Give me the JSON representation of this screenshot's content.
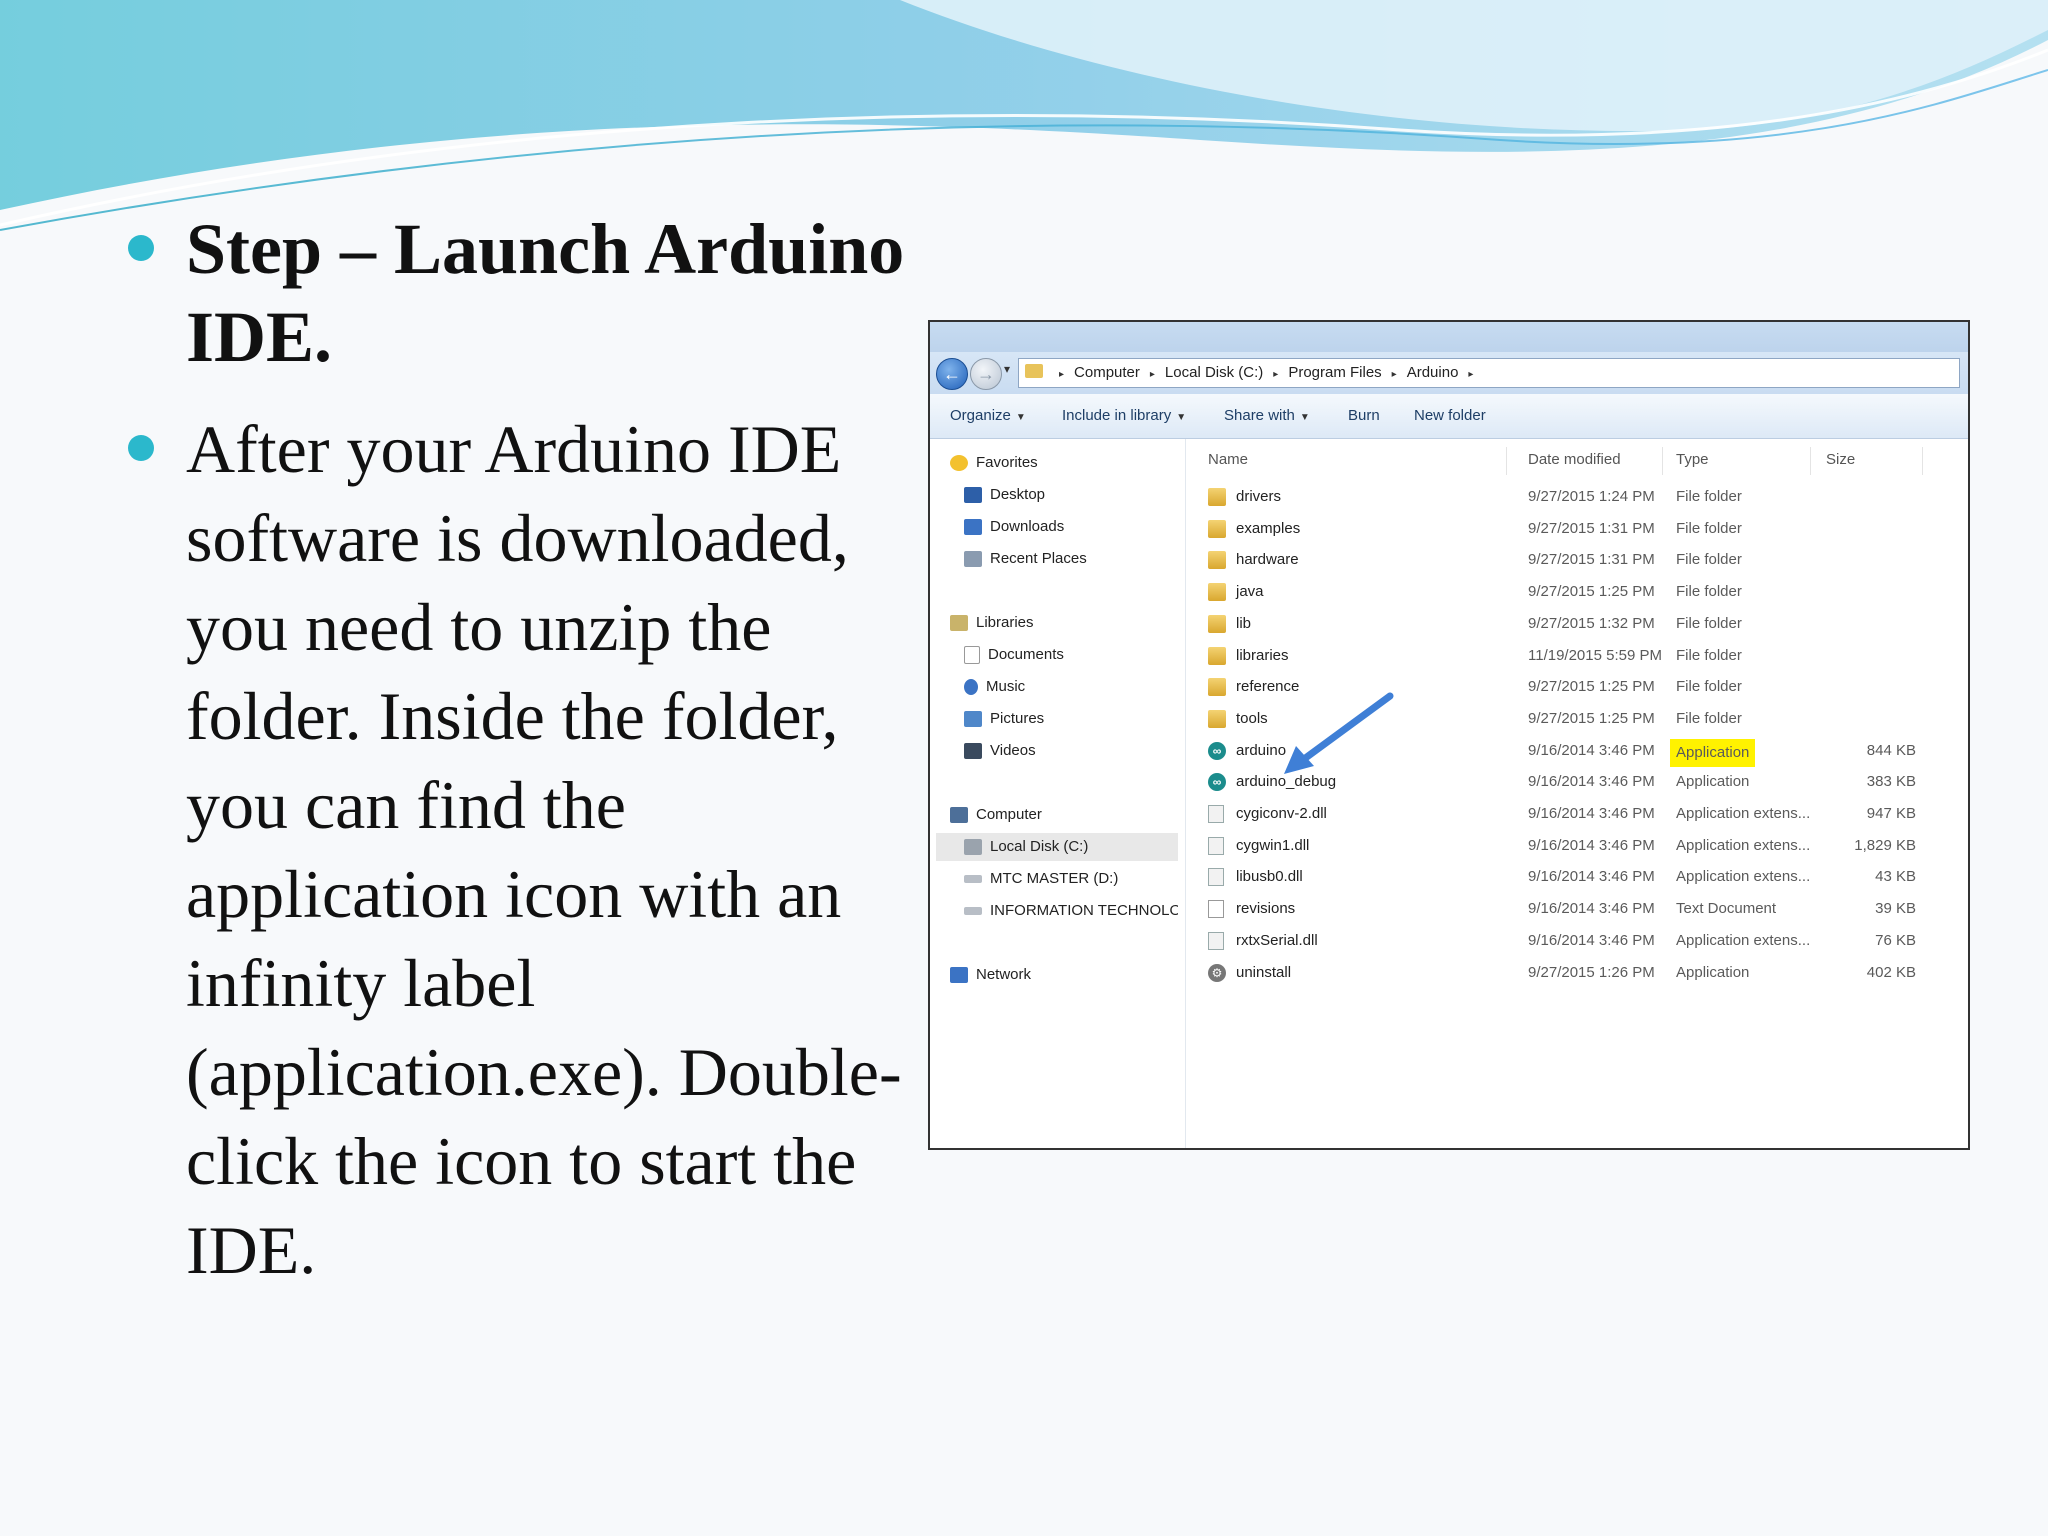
{
  "slide": {
    "heading": "Step  – Launch Arduino IDE.",
    "body": "After your Arduino IDE software is downloaded, you need to unzip the folder. Inside the folder, you can find the application icon with an infinity label (application.exe). Double-click the icon to start the IDE."
  },
  "explorer": {
    "breadcrumbs": [
      "Computer",
      "Local Disk (C:)",
      "Program Files",
      "Arduino"
    ],
    "toolbar": {
      "organize": "Organize",
      "include": "Include in library",
      "share": "Share with",
      "burn": "Burn",
      "new_folder": "New folder"
    },
    "nav": {
      "favorites": "Favorites",
      "desktop": "Desktop",
      "downloads": "Downloads",
      "recent": "Recent Places",
      "libraries": "Libraries",
      "documents": "Documents",
      "music": "Music",
      "pictures": "Pictures",
      "videos": "Videos",
      "computer": "Computer",
      "local_disk": "Local Disk (C:)",
      "mtc": "MTC MASTER  (D:)",
      "info": "INFORMATION TECHNOLOG",
      "network": "Network"
    },
    "columns": {
      "name": "Name",
      "date": "Date modified",
      "type": "Type",
      "size": "Size"
    },
    "files": [
      {
        "name": "drivers",
        "date": "9/27/2015 1:24 PM",
        "type": "File folder",
        "size": "",
        "icon": "folder-icon"
      },
      {
        "name": "examples",
        "date": "9/27/2015 1:31 PM",
        "type": "File folder",
        "size": "",
        "icon": "folder-icon"
      },
      {
        "name": "hardware",
        "date": "9/27/2015 1:31 PM",
        "type": "File folder",
        "size": "",
        "icon": "folder-icon"
      },
      {
        "name": "java",
        "date": "9/27/2015 1:25 PM",
        "type": "File folder",
        "size": "",
        "icon": "folder-icon"
      },
      {
        "name": "lib",
        "date": "9/27/2015 1:32 PM",
        "type": "File folder",
        "size": "",
        "icon": "folder-icon"
      },
      {
        "name": "libraries",
        "date": "11/19/2015 5:59 PM",
        "type": "File folder",
        "size": "",
        "icon": "folder-icon"
      },
      {
        "name": "reference",
        "date": "9/27/2015 1:25 PM",
        "type": "File folder",
        "size": "",
        "icon": "folder-icon"
      },
      {
        "name": "tools",
        "date": "9/27/2015 1:25 PM",
        "type": "File folder",
        "size": "",
        "icon": "folder-icon"
      },
      {
        "name": "arduino",
        "date": "9/16/2014 3:46 PM",
        "type": "Application",
        "size": "844 KB",
        "icon": "arduino-icon"
      },
      {
        "name": "arduino_debug",
        "date": "9/16/2014 3:46 PM",
        "type": "Application",
        "size": "383 KB",
        "icon": "arduino-icon"
      },
      {
        "name": "cygiconv-2.dll",
        "date": "9/16/2014 3:46 PM",
        "type": "Application extens...",
        "size": "947 KB",
        "icon": "dll-icon"
      },
      {
        "name": "cygwin1.dll",
        "date": "9/16/2014 3:46 PM",
        "type": "Application extens...",
        "size": "1,829 KB",
        "icon": "dll-icon"
      },
      {
        "name": "libusb0.dll",
        "date": "9/16/2014 3:46 PM",
        "type": "Application extens...",
        "size": "43 KB",
        "icon": "dll-icon"
      },
      {
        "name": "revisions",
        "date": "9/16/2014 3:46 PM",
        "type": "Text Document",
        "size": "39 KB",
        "icon": "text-document-icon"
      },
      {
        "name": "rxtxSerial.dll",
        "date": "9/16/2014 3:46 PM",
        "type": "Application extens...",
        "size": "76 KB",
        "icon": "dll-icon"
      },
      {
        "name": "uninstall",
        "date": "9/27/2015 1:26 PM",
        "type": "Application",
        "size": "402 KB",
        "icon": "uninstaller-icon"
      }
    ]
  },
  "colors": {
    "bullet": "#2bb8cc",
    "highlight": "#fff200",
    "arrow": "#3f7fd6"
  }
}
